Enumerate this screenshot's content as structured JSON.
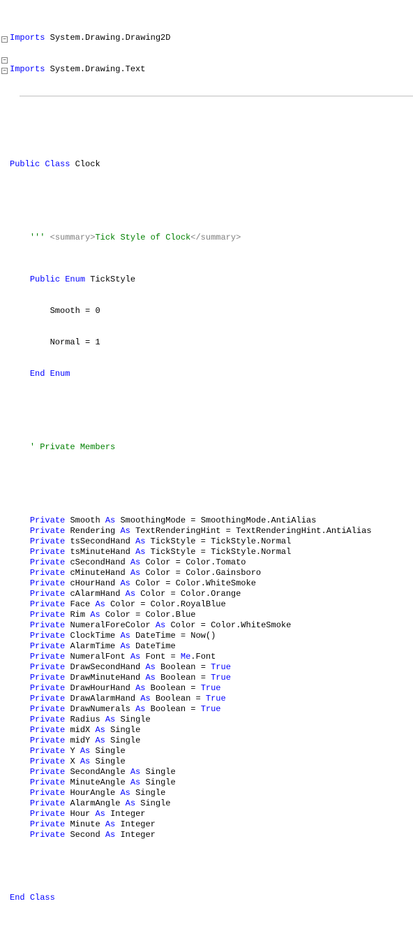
{
  "imports": [
    "System.Drawing.Drawing2D",
    "System.Drawing.Text"
  ],
  "class_decl": {
    "kw1": "Public",
    "kw2": "Class",
    "name": "Clock"
  },
  "summary": {
    "prefix": "'''",
    "open": "<summary>",
    "text": "Tick Style of Clock",
    "close": "</summary>"
  },
  "enum": {
    "decl": {
      "kw1": "Public",
      "kw2": "Enum",
      "name": "TickStyle"
    },
    "members": [
      {
        "name": "Smooth",
        "eq": "=",
        "val": "0"
      },
      {
        "name": "Normal",
        "eq": "=",
        "val": "1"
      }
    ],
    "end": {
      "kw1": "End",
      "kw2": "Enum"
    }
  },
  "section_comment": "' Private Members",
  "decls": [
    {
      "name": "Smooth",
      "type": "SmoothingMode",
      "rest": " = SmoothingMode.AntiAlias"
    },
    {
      "name": "Rendering",
      "type": "TextRenderingHint",
      "rest": " = TextRenderingHint.AntiAlias"
    },
    {
      "name": "tsSecondHand",
      "type": "TickStyle",
      "rest": " = TickStyle.Normal"
    },
    {
      "name": "tsMinuteHand",
      "type": "TickStyle",
      "rest": " = TickStyle.Normal"
    },
    {
      "name": "cSecondHand",
      "type": "Color",
      "rest": " = Color.Tomato"
    },
    {
      "name": "cMinuteHand",
      "type": "Color",
      "rest": " = Color.Gainsboro"
    },
    {
      "name": "cHourHand",
      "type": "Color",
      "rest": " = Color.WhiteSmoke"
    },
    {
      "name": "cAlarmHand",
      "type": "Color",
      "rest": " = Color.Orange"
    },
    {
      "name": "Face",
      "type": "Color",
      "rest": " = Color.RoyalBlue"
    },
    {
      "name": "Rim",
      "type": "Color",
      "rest": " = Color.Blue"
    },
    {
      "name": "NumeralForeColor",
      "type": "Color",
      "rest": " = Color.WhiteSmoke"
    },
    {
      "name": "ClockTime",
      "type": "DateTime",
      "rest": " = Now()"
    },
    {
      "name": "AlarmTime",
      "type": "DateTime",
      "rest": ""
    },
    {
      "name": "NumeralFont",
      "type": "Font",
      "rest_pre": " = ",
      "rest_kw": "Me",
      "rest_post": ".Font"
    },
    {
      "name": "DrawSecondHand",
      "type": "Boolean",
      "rest_pre": " = ",
      "rest_kw": "True",
      "rest_post": ""
    },
    {
      "name": "DrawMinuteHand",
      "type": "Boolean",
      "rest_pre": " = ",
      "rest_kw": "True",
      "rest_post": ""
    },
    {
      "name": "DrawHourHand",
      "type": "Boolean",
      "rest_pre": " = ",
      "rest_kw": "True",
      "rest_post": ""
    },
    {
      "name": "DrawAlarmHand",
      "type": "Boolean",
      "rest_pre": " = ",
      "rest_kw": "True",
      "rest_post": ""
    },
    {
      "name": "DrawNumerals",
      "type": "Boolean",
      "rest_pre": " = ",
      "rest_kw": "True",
      "rest_post": ""
    },
    {
      "name": "Radius",
      "type": "Single",
      "rest": ""
    },
    {
      "name": "midX",
      "type": "Single",
      "rest": ""
    },
    {
      "name": "midY",
      "type": "Single",
      "rest": ""
    },
    {
      "name": "Y",
      "type": "Single",
      "rest": ""
    },
    {
      "name": "X",
      "type": "Single",
      "rest": ""
    },
    {
      "name": "SecondAngle",
      "type": "Single",
      "rest": ""
    },
    {
      "name": "MinuteAngle",
      "type": "Single",
      "rest": ""
    },
    {
      "name": "HourAngle",
      "type": "Single",
      "rest": ""
    },
    {
      "name": "AlarmAngle",
      "type": "Single",
      "rest": ""
    },
    {
      "name": "Hour",
      "type": "Integer",
      "rest": ""
    },
    {
      "name": "Minute",
      "type": "Integer",
      "rest": ""
    },
    {
      "name": "Second",
      "type": "Integer",
      "rest": ""
    }
  ],
  "end_class": {
    "kw1": "End",
    "kw2": "Class"
  },
  "kw": {
    "Imports": "Imports",
    "Private": "Private",
    "As": "As"
  }
}
